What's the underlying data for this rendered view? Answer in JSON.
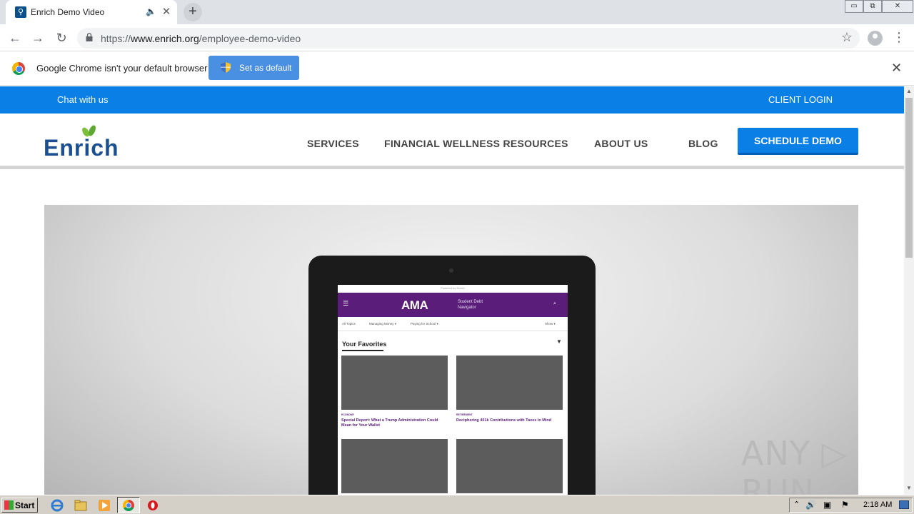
{
  "browser": {
    "tab": {
      "title": "Enrich Demo Video",
      "favicon": "enrich-icon",
      "audio_icon": "speaker-icon"
    },
    "new_tab_symbol": "+",
    "url": {
      "scheme": "https://",
      "host": "www.enrich.org",
      "path": "/employee-demo-video"
    },
    "window_controls": {
      "minimize": "▭",
      "restore": "⧉",
      "close": "✕"
    },
    "infobar": {
      "message": "Google Chrome isn't your default browser",
      "button_label": "Set as default",
      "close": "✕"
    }
  },
  "site": {
    "topbar": {
      "chat": "Chat with us",
      "client_login": "CLIENT LOGIN"
    },
    "logo": {
      "text": "Enrich",
      "leaf_color": "#7bbf3a",
      "text_color": "#1c4f8f"
    },
    "nav": {
      "services": "SERVICES",
      "resources": "FINANCIAL WELLNESS RESOURCES",
      "about": "ABOUT US",
      "blog": "BLOG",
      "cta": "SCHEDULE DEMO"
    },
    "accent_color": "#0a7fe6"
  },
  "video_frame": {
    "powered_by": "Powered by Enrich",
    "app_logo": "AMA",
    "app_subtitle": "Student Debt Navigator",
    "tabs": [
      "All Topics",
      "Managing Money ▾",
      "Paying for School ▾",
      "Show ▾"
    ],
    "section_title": "Your Favorites",
    "cards": [
      {
        "category": "ECONOMY",
        "title": "Special Report: What a Trump Administration Could Mean for Your Wallet"
      },
      {
        "category": "RETIREMENT",
        "title": "Deciphering 401k Contributions with Taxes in Mind"
      }
    ],
    "theme_color": "#5a1e7a"
  },
  "watermark": "ANY ▷ RUN",
  "taskbar": {
    "start_label": "Start",
    "clock": "2:18 AM"
  }
}
